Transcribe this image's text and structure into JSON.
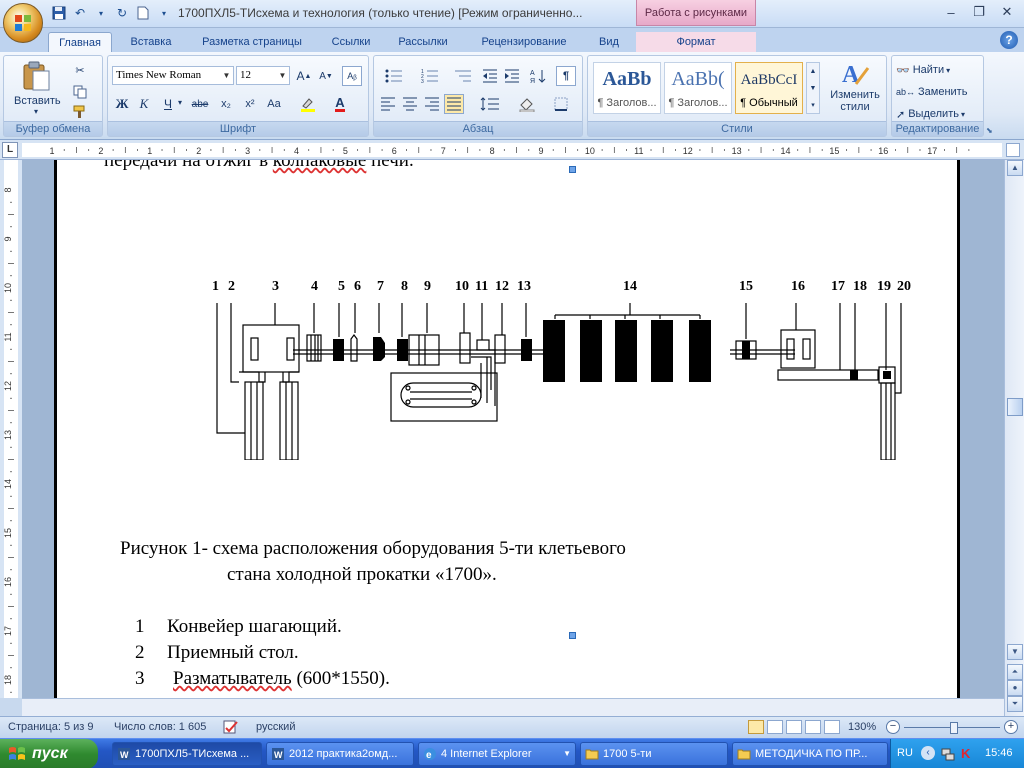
{
  "window": {
    "title": "1700ПХЛ5-ТИсхема и технология (только чтение) [Режим ограниченно...",
    "context_tab": "Работа с рисунками"
  },
  "tabs": [
    {
      "label": "Главная",
      "active": true
    },
    {
      "label": "Вставка"
    },
    {
      "label": "Разметка страницы"
    },
    {
      "label": "Ссылки"
    },
    {
      "label": "Рассылки"
    },
    {
      "label": "Рецензирование"
    },
    {
      "label": "Вид"
    },
    {
      "label": "Формат"
    }
  ],
  "ribbon": {
    "clipboard": {
      "label": "Буфер обмена",
      "paste_label": "Вставить"
    },
    "font": {
      "label": "Шрифт",
      "font_name": "Times New Roman",
      "font_size": "12",
      "bold": "Ж",
      "italic": "К",
      "underline": "Ч",
      "strike": "abe",
      "sub": "x₂",
      "sup": "x²",
      "case": "Aa"
    },
    "paragraph": {
      "label": "Абзац"
    },
    "styles": {
      "label": "Стили",
      "cards": [
        {
          "preview": "AaBb",
          "name": "¶ Заголов..."
        },
        {
          "preview": "AaBb(",
          "name": "¶ Заголов..."
        },
        {
          "preview": "AaBbCcI",
          "name": "¶ Обычный"
        }
      ],
      "change_label_1": "Изменить",
      "change_label_2": "стили"
    },
    "editing": {
      "label": "Редактирование",
      "find": "Найти",
      "replace": "Заменить",
      "select": "Выделить"
    }
  },
  "ruler": {
    "h_ticks": [
      "1",
      "2",
      "1",
      "2",
      "3",
      "4",
      "5",
      "6",
      "7",
      "8",
      "9",
      "10",
      "11",
      "12",
      "13",
      "14",
      "15",
      "16",
      "17"
    ],
    "v_ticks": [
      "8",
      "9",
      "10",
      "11",
      "12",
      "13",
      "14",
      "15",
      "16",
      "17",
      "18"
    ]
  },
  "document": {
    "top_line": "передачи на отжиг в колпаковые печи.",
    "top_line_plain": "передачи на отжиг в ",
    "top_line_squiggle": "колпаковые",
    "top_line_end": " печи.",
    "diagram_labels": [
      "1",
      "2",
      "3",
      "4",
      "5",
      "6",
      "7",
      "8",
      "9",
      "10",
      "11",
      "12",
      "13",
      "14",
      "15",
      "16",
      "17",
      "18",
      "19",
      "20"
    ],
    "caption_line1": "Рисунок 1- схема расположения оборудования 5-ти клетьевого",
    "caption_line2": "стана холодной прокатки «1700».",
    "list": [
      {
        "num": "1",
        "text": "Конвейер шагающий."
      },
      {
        "num": "2",
        "text": "Приемный стол."
      },
      {
        "num": "3",
        "text_plain": "Разматыватель (600*1550).",
        "text_squiggle": "Разматыватель",
        "text_rest": " (600*1550)."
      }
    ]
  },
  "status": {
    "page": "Страница: 5 из 9",
    "words": "Число слов: 1 605",
    "language": "русский",
    "zoom": "130%"
  },
  "taskbar": {
    "start": "пуск",
    "tasks": [
      {
        "label": "1700ПХЛ5-ТИсхема ..."
      },
      {
        "label": "2012 практика2омд..."
      },
      {
        "label": "4 Internet Explorer"
      },
      {
        "label": "1700 5-ти"
      },
      {
        "label": "МЕТОДИЧКА ПО ПР..."
      }
    ],
    "lang": "RU",
    "clock": "15:46"
  },
  "colors": {
    "ribbon_text": "#15428b",
    "context_tab": "#e7a9c9",
    "taskbar": "#2457c5",
    "start": "#2f8a2f"
  }
}
